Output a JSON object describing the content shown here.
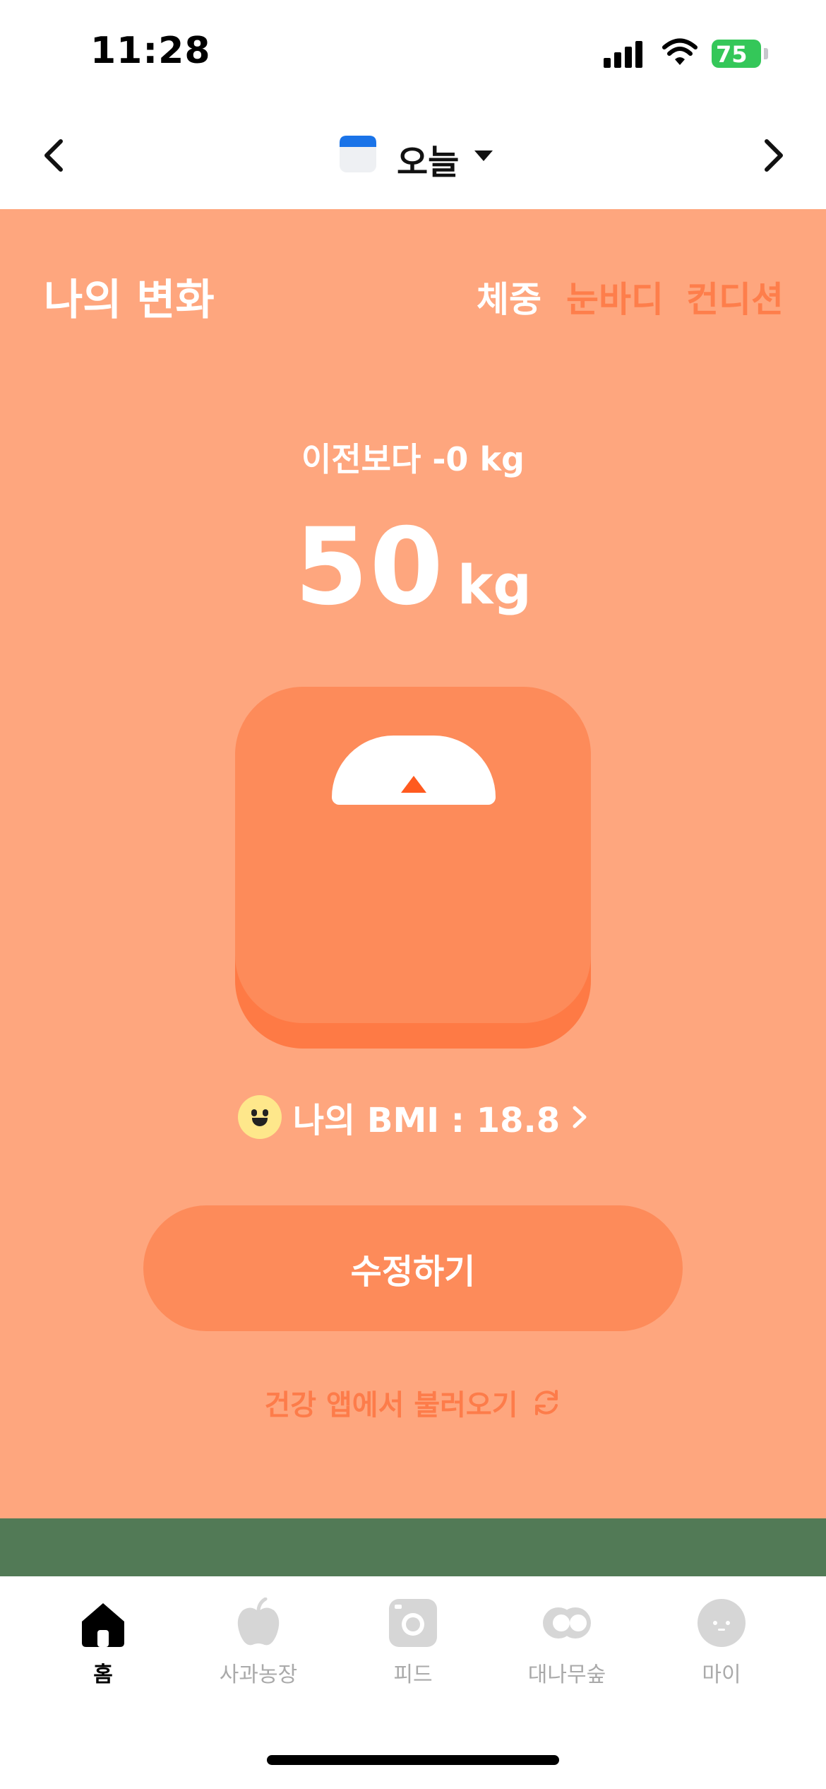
{
  "status_bar": {
    "time": "11:28",
    "battery": "75"
  },
  "header": {
    "title": "오늘"
  },
  "section": {
    "title": "나의 변화",
    "tabs": [
      {
        "label": "체중",
        "active": true
      },
      {
        "label": "눈바디",
        "active": false
      },
      {
        "label": "컨디션",
        "active": false
      }
    ]
  },
  "weight": {
    "compare_text": "이전보다 -0 kg",
    "value": "50",
    "unit": "kg"
  },
  "bmi": {
    "label": "나의 BMI : 18.8"
  },
  "actions": {
    "edit_label": "수정하기",
    "import_label": "건강 앱에서 불러오기"
  },
  "tabbar": {
    "items": [
      {
        "label": "홈",
        "icon": "home-icon",
        "active": true
      },
      {
        "label": "사과농장",
        "icon": "apple-icon",
        "active": false
      },
      {
        "label": "피드",
        "icon": "camera-icon",
        "active": false
      },
      {
        "label": "대나무숲",
        "icon": "cc-icon",
        "active": false
      },
      {
        "label": "마이",
        "icon": "face-icon",
        "active": false
      }
    ]
  },
  "colors": {
    "card_bg": "#fea67e",
    "accent": "#fd8b5a",
    "inactive_tab": "#fe7e4b",
    "strip": "#527a56"
  }
}
